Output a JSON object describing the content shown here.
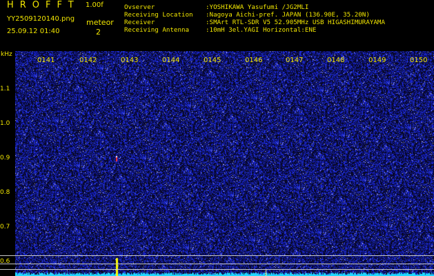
{
  "header": {
    "app_title": "HROFFT",
    "version": "1.00f",
    "filename": "YY2509120140.png",
    "datetime": "25.09.12 01:40",
    "meteor_label": "meteor",
    "meteor_count": "2"
  },
  "info": [
    {
      "key": "Ovserver",
      "value": ":YOSHIKAWA Yasufumi /JG2MLI"
    },
    {
      "key": "Receiving Location",
      "value": ":Nagoya Aichi-pref. JAPAN (136.90E, 35.20N)"
    },
    {
      "key": "Receiver",
      "value": ":SMArt RTL-SDR V5 52.905MHz USB HIGASHIMURAYAMA"
    },
    {
      "key": "Receiving Antenna",
      "value": ":10mH 3el.YAGI Horizontal:ENE"
    }
  ],
  "axes": {
    "y_unit": "kHz",
    "y_ticks": [
      "1.1",
      "1.0",
      "0.9",
      "0.8",
      "0.7",
      "0.6"
    ],
    "x_ticks": [
      "0141",
      "0142",
      "0143",
      "0144",
      "0145",
      "0146",
      "0147",
      "0148",
      "0149",
      "0150"
    ]
  },
  "colors": {
    "text": "#f2e600",
    "background": "#000000",
    "noise_dark": "#0a0a30",
    "noise_blue": "#2a3cff",
    "baseline": "#20d8ff",
    "marker_line": "#c9c9c9"
  },
  "events": [
    {
      "label": "meteor echo",
      "time": "01:42.8",
      "freq_khz": 0.9
    },
    {
      "label": "meteor echo",
      "time": "01:42.9",
      "freq_khz": 0.62
    }
  ]
}
